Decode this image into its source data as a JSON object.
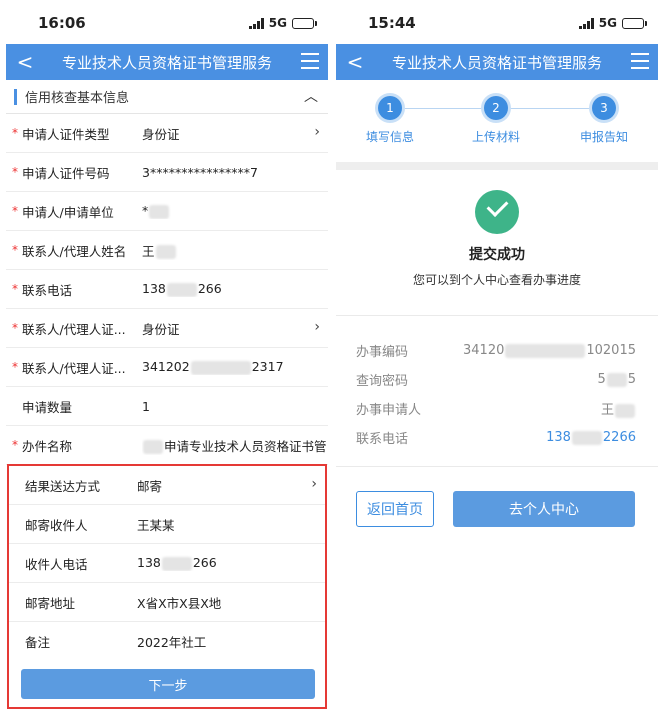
{
  "left": {
    "status": {
      "time": "16:06",
      "network": "5G"
    },
    "nav": {
      "back": "<",
      "title": "专业技术人员资格证书管理服务"
    },
    "section": {
      "title": "信用核查基本信息",
      "collapse": "︿"
    },
    "rows": [
      {
        "label": "申请人证件类型",
        "value": "身份证",
        "required": "*",
        "chevron": "›"
      },
      {
        "label": "申请人证件号码",
        "value": "3****************7",
        "required": "*"
      },
      {
        "label": "申请人/申请单位",
        "value": "*",
        "required": "*"
      },
      {
        "label": "联系人/代理人姓名",
        "value": "王",
        "required": "*"
      },
      {
        "label": "联系电话",
        "value_a": "138",
        "value_b": "266",
        "required": "*"
      },
      {
        "label": "联系人/代理人证...",
        "value": "身份证",
        "required": "*",
        "chevron": "›"
      },
      {
        "label": "联系人/代理人证...",
        "value_a": "341202",
        "value_b": "2317",
        "required": "*"
      },
      {
        "label": "申请数量",
        "value": "1",
        "required": ""
      },
      {
        "label": "办件名称",
        "value": "申请专业技术人员资格证书管",
        "required": "*"
      }
    ],
    "delivery": [
      {
        "label": "结果送达方式",
        "value": "邮寄",
        "chevron": "›"
      },
      {
        "label": "邮寄收件人",
        "value": "王某某"
      },
      {
        "label": "收件人电话",
        "value_a": "138",
        "value_b": "266"
      },
      {
        "label": "邮寄地址",
        "value": "X省X市X县X地"
      },
      {
        "label": "备注",
        "value": "2022年社工"
      }
    ],
    "next_label": "下一步"
  },
  "right": {
    "status": {
      "time": "15:44",
      "network": "5G"
    },
    "nav": {
      "back": "<",
      "title": "专业技术人员资格证书管理服务"
    },
    "steps": [
      {
        "num": "1",
        "label": "填写信息"
      },
      {
        "num": "2",
        "label": "上传材料"
      },
      {
        "num": "3",
        "label": "申报告知"
      }
    ],
    "success": {
      "title": "提交成功",
      "subtitle": "您可以到个人中心查看办事进度"
    },
    "info": [
      {
        "label": "办事编码",
        "value_a": "34120",
        "value_b": "102015"
      },
      {
        "label": "查询密码",
        "value_a": "5",
        "value_b": "5"
      },
      {
        "label": "办事申请人",
        "value_a": "王",
        "value_b": ""
      },
      {
        "label": "联系电话",
        "value_a": "138",
        "value_b": "2266"
      }
    ],
    "btn_home": "返回首页",
    "btn_center": "去个人中心"
  },
  "colors": {
    "primary": "#4a90e2",
    "button": "#5b9be0",
    "success": "#3eb489",
    "required": "#e33333",
    "highlight": "#e53935"
  }
}
